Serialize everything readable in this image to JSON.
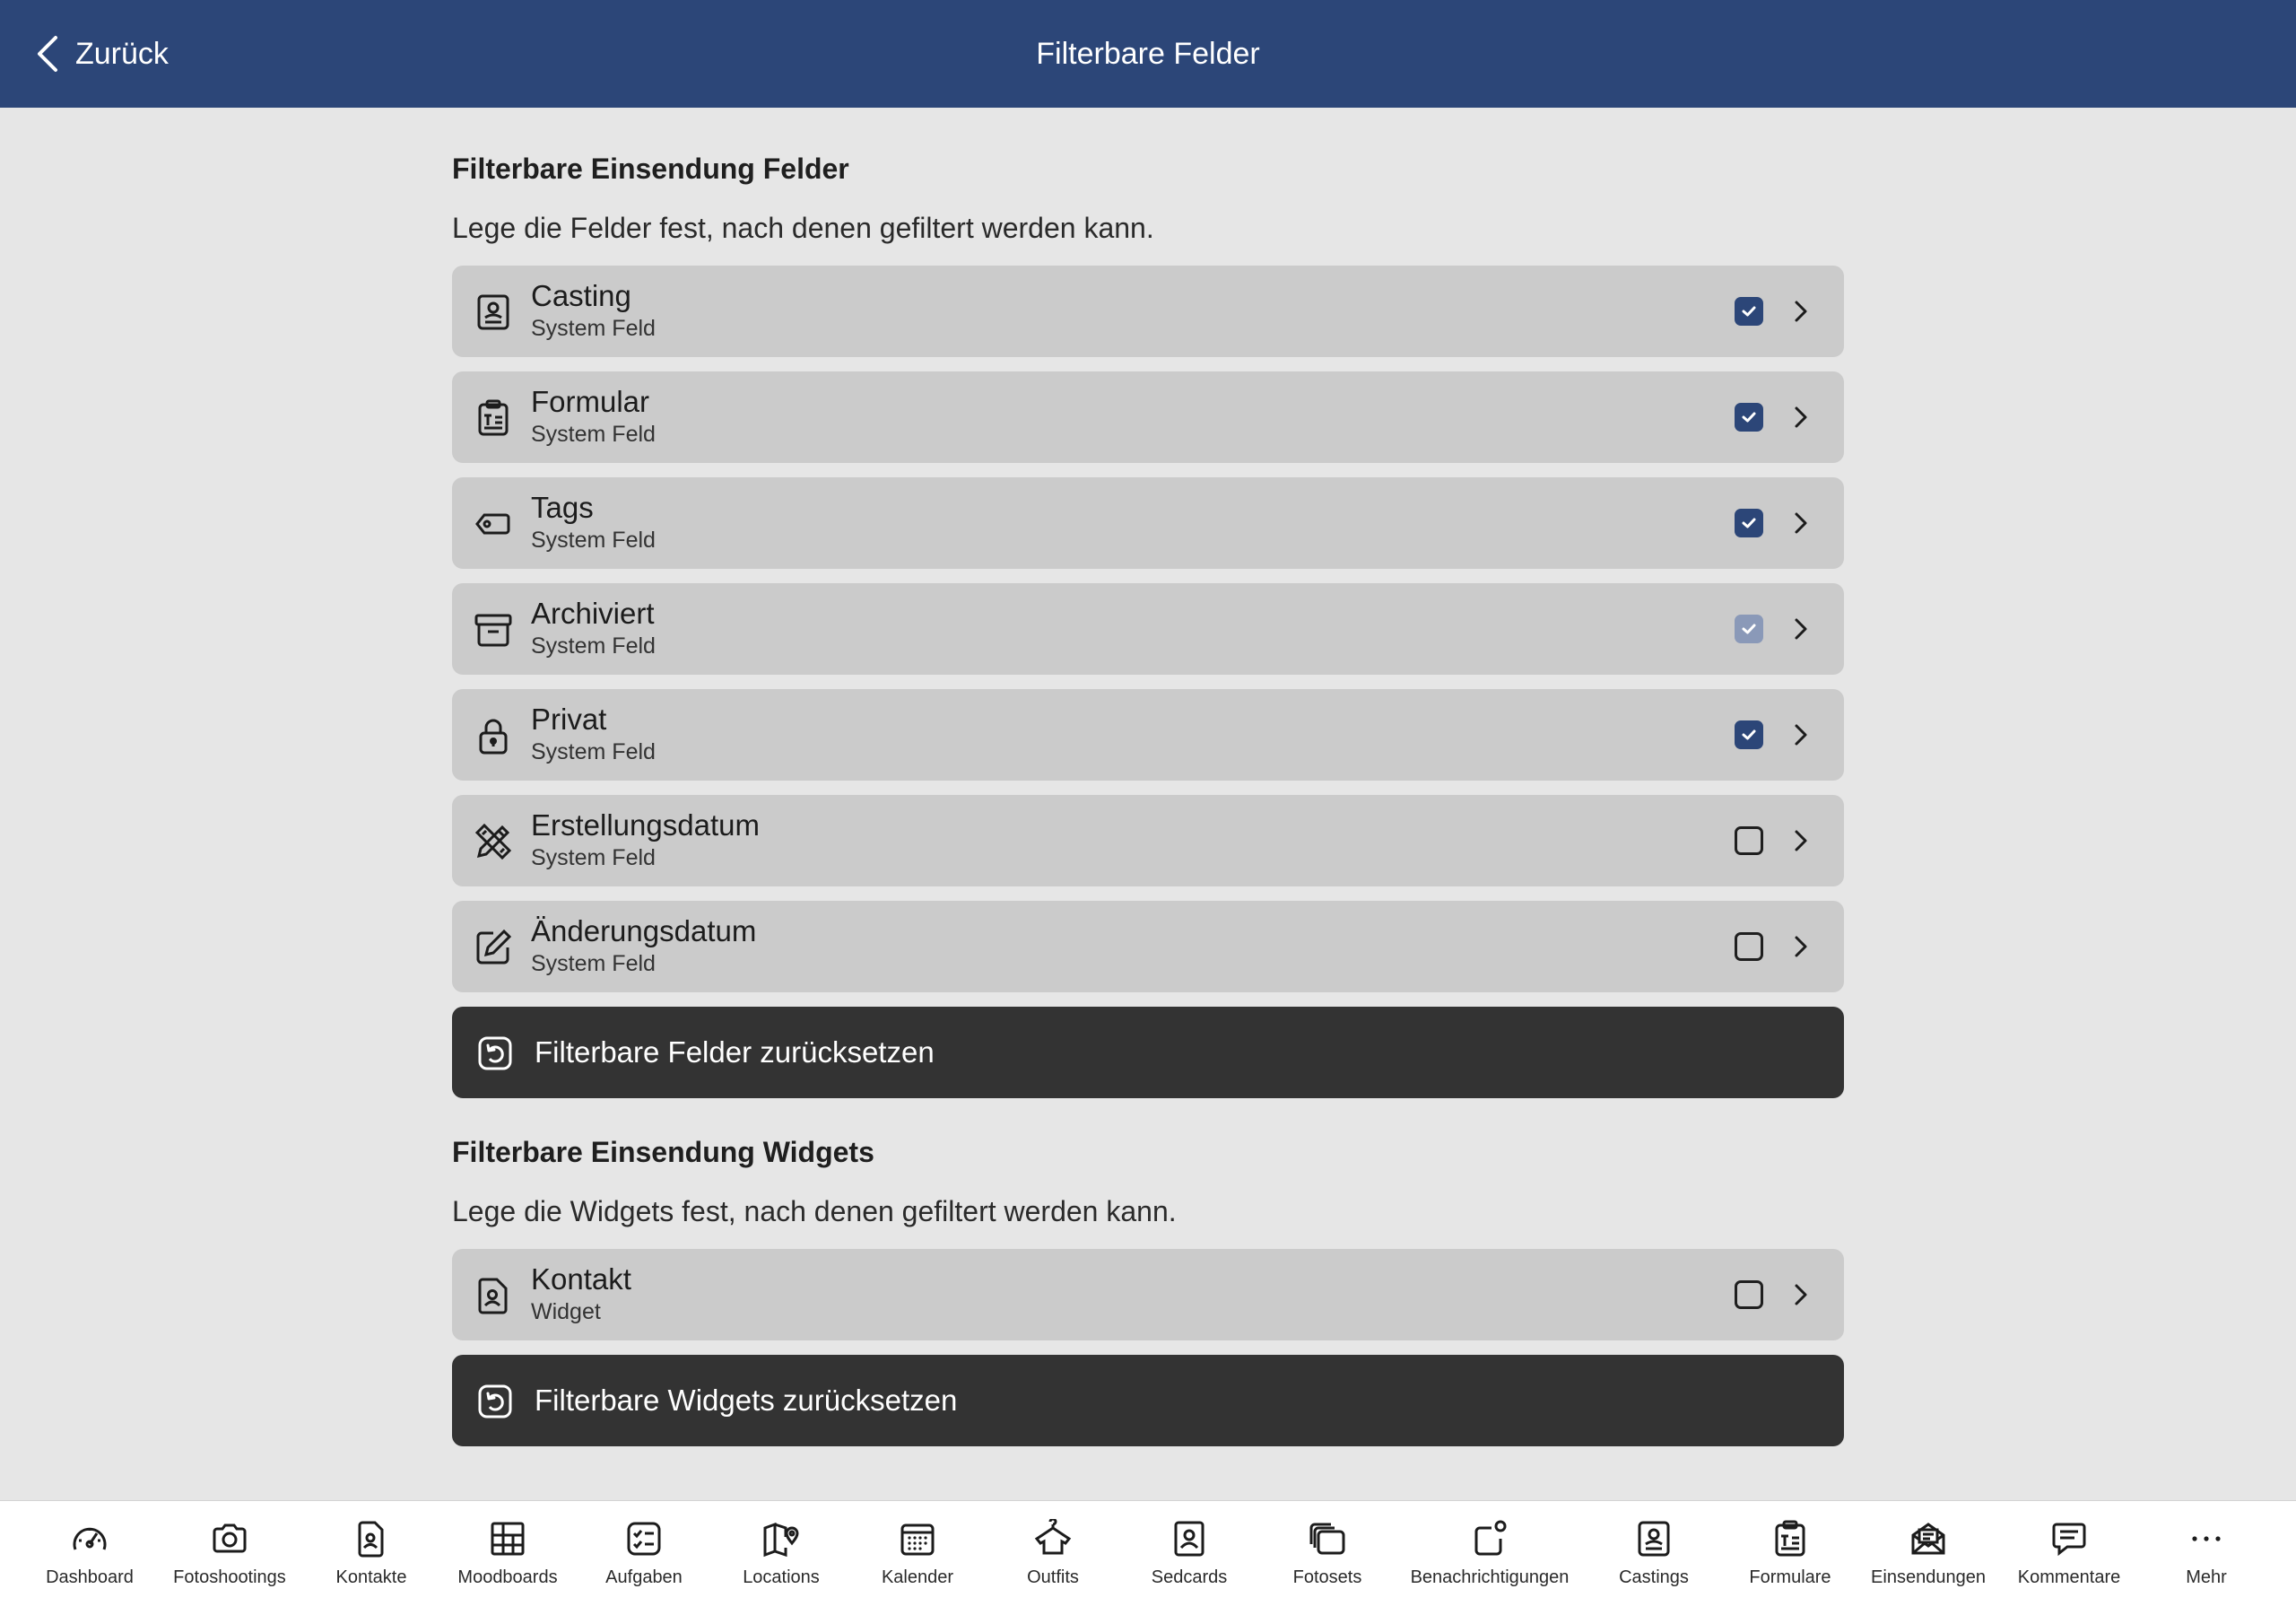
{
  "header": {
    "back_label": "Zurück",
    "title": "Filterbare Felder"
  },
  "fields_section": {
    "title": "Filterbare Einsendung Felder",
    "description": "Lege die Felder fest, nach denen gefiltert werden kann.",
    "items": [
      {
        "title": "Casting",
        "subtitle": "System Feld",
        "icon": "casting-icon",
        "checked": true,
        "disabled": false
      },
      {
        "title": "Formular",
        "subtitle": "System Feld",
        "icon": "clipboard-icon",
        "checked": true,
        "disabled": false
      },
      {
        "title": "Tags",
        "subtitle": "System Feld",
        "icon": "tag-icon",
        "checked": true,
        "disabled": false
      },
      {
        "title": "Archiviert",
        "subtitle": "System Feld",
        "icon": "archive-icon",
        "checked": true,
        "disabled": true
      },
      {
        "title": "Privat",
        "subtitle": "System Feld",
        "icon": "lock-icon",
        "checked": true,
        "disabled": false
      },
      {
        "title": "Erstellungsdatum",
        "subtitle": "System Feld",
        "icon": "pencil-ruler-icon",
        "checked": false,
        "disabled": false
      },
      {
        "title": "Änderungsdatum",
        "subtitle": "System Feld",
        "icon": "edit-icon",
        "checked": false,
        "disabled": false
      }
    ],
    "reset_label": "Filterbare Felder zurücksetzen"
  },
  "widgets_section": {
    "title": "Filterbare Einsendung Widgets",
    "description": "Lege die Widgets fest, nach denen gefiltert werden kann.",
    "items": [
      {
        "title": "Kontakt",
        "subtitle": "Widget",
        "icon": "contact-file-icon",
        "checked": false,
        "disabled": false
      }
    ],
    "reset_label": "Filterbare Widgets zurücksetzen"
  },
  "tabbar": {
    "items": [
      {
        "label": "Dashboard",
        "icon": "gauge-icon"
      },
      {
        "label": "Fotoshootings",
        "icon": "camera-icon"
      },
      {
        "label": "Kontakte",
        "icon": "contact-file-icon"
      },
      {
        "label": "Moodboards",
        "icon": "grid-icon"
      },
      {
        "label": "Aufgaben",
        "icon": "tasks-icon"
      },
      {
        "label": "Locations",
        "icon": "map-icon"
      },
      {
        "label": "Kalender",
        "icon": "calendar-icon"
      },
      {
        "label": "Outfits",
        "icon": "shirt-icon"
      },
      {
        "label": "Sedcards",
        "icon": "sedcard-icon"
      },
      {
        "label": "Fotosets",
        "icon": "photosets-icon"
      },
      {
        "label": "Benachrichtigungen",
        "icon": "notification-icon"
      },
      {
        "label": "Castings",
        "icon": "casting-icon"
      },
      {
        "label": "Formulare",
        "icon": "clipboard-icon"
      },
      {
        "label": "Einsendungen",
        "icon": "mail-open-icon"
      },
      {
        "label": "Kommentare",
        "icon": "comment-icon"
      },
      {
        "label": "Mehr",
        "icon": "more-icon"
      }
    ]
  },
  "colors": {
    "header_bg": "#2c4678",
    "accent": "#2c4678",
    "row_bg": "#cbcbcb",
    "button_bg": "#333333",
    "page_bg": "#e6e6e6"
  }
}
